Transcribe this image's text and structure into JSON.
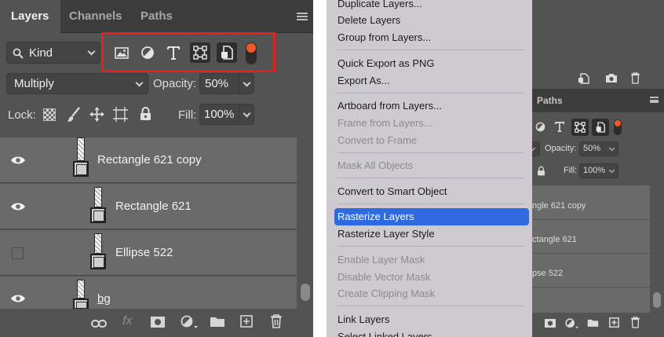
{
  "layers_panel": {
    "tabs": [
      "Layers",
      "Channels",
      "Paths"
    ],
    "filter": {
      "kind_label": "Kind",
      "highlight_color": "#e0221f",
      "toggle_color": "#f05a28"
    },
    "blend_mode": "Multiply",
    "opacity_label": "Opacity:",
    "opacity_value": "50%",
    "lock_label": "Lock:",
    "fill_label": "Fill:",
    "fill_value": "100%",
    "layers": [
      {
        "name": "Rectangle 621 copy",
        "visible": true
      },
      {
        "name": "Rectangle 621",
        "visible": true
      },
      {
        "name": "Ellipse 522",
        "visible": false
      },
      {
        "name": "bg",
        "visible": true
      }
    ],
    "footer_fx": "fx"
  },
  "context_menu": {
    "items": [
      {
        "label": "Duplicate Layers...",
        "state": "enabled"
      },
      {
        "label": "Delete Layers",
        "state": "enabled"
      },
      {
        "label": "Group from Layers...",
        "state": "enabled"
      },
      {
        "label": "Quick Export as PNG",
        "state": "enabled"
      },
      {
        "label": "Export As...",
        "state": "enabled"
      },
      {
        "label": "Artboard from Layers...",
        "state": "enabled"
      },
      {
        "label": "Frame from Layers...",
        "state": "disabled"
      },
      {
        "label": "Convert to Frame",
        "state": "disabled"
      },
      {
        "label": "Mask All Objects",
        "state": "disabled"
      },
      {
        "label": "Convert to Smart Object",
        "state": "enabled"
      },
      {
        "label": "Rasterize Layers",
        "state": "highlighted"
      },
      {
        "label": "Rasterize Layer Style",
        "state": "enabled"
      },
      {
        "label": "Enable Layer Mask",
        "state": "disabled"
      },
      {
        "label": "Disable Vector Mask",
        "state": "disabled"
      },
      {
        "label": "Create Clipping Mask",
        "state": "disabled"
      },
      {
        "label": "Link Layers",
        "state": "enabled"
      },
      {
        "label": "Select Linked Layers",
        "state": "enabled"
      }
    ],
    "highlight_color": "#2f6ae0"
  },
  "background_panel": {
    "tab": "Paths",
    "opacity_label": "Opacity:",
    "opacity_value": "50%",
    "fill_label": "Fill:",
    "fill_value": "100%",
    "layer_names": [
      "ngle 621 copy",
      "ctangle 621",
      "pse 522"
    ]
  }
}
